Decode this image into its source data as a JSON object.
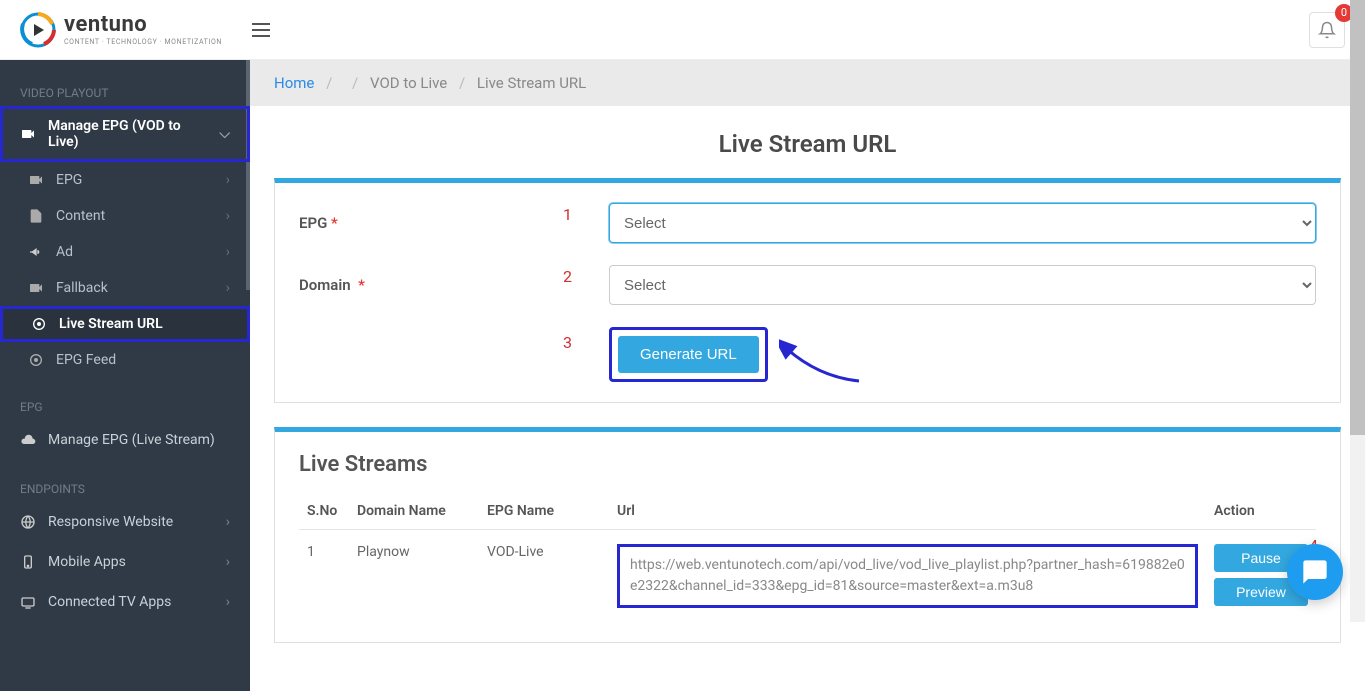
{
  "brand": {
    "name": "ventuno",
    "tagline": "CONTENT · TECHNOLOGY · MONETIZATION"
  },
  "notifications": {
    "count": "0"
  },
  "sidebar": {
    "section_playout": "VIDEO PLAYOUT",
    "manage_epg_vod": "Manage EPG (VOD to Live)",
    "items": {
      "epg": "EPG",
      "content": "Content",
      "ad": "Ad",
      "fallback": "Fallback",
      "live_stream_url": "Live Stream URL",
      "epg_feed": "EPG Feed"
    },
    "section_epg": "EPG",
    "manage_epg_live": "Manage EPG (Live Stream)",
    "section_endpoints": "ENDPOINTS",
    "endpoints": {
      "responsive": "Responsive Website",
      "mobile": "Mobile Apps",
      "ctv": "Connected TV Apps"
    }
  },
  "breadcrumb": {
    "home": "Home",
    "vod_to_live": "VOD to Live",
    "current": "Live Stream URL"
  },
  "page_title": "Live Stream URL",
  "form": {
    "epg_label": "EPG",
    "domain_label": "Domain",
    "select_placeholder": "Select",
    "generate_label": "Generate URL",
    "step1": "1",
    "step2": "2",
    "step3": "3",
    "step4": "4"
  },
  "streams": {
    "title": "Live Streams",
    "columns": {
      "sno": "S.No",
      "domain": "Domain Name",
      "epg": "EPG Name",
      "url": "Url",
      "action": "Action"
    },
    "rows": [
      {
        "sno": "1",
        "domain": "Playnow",
        "epg": "VOD-Live",
        "url": "https://web.ventunotech.com/api/vod_live/vod_live_playlist.php?partner_hash=619882e0e2322&channel_id=333&epg_id=81&source=master&ext=a.m3u8"
      }
    ],
    "pause_label": "Pause",
    "preview_label": "Preview"
  }
}
